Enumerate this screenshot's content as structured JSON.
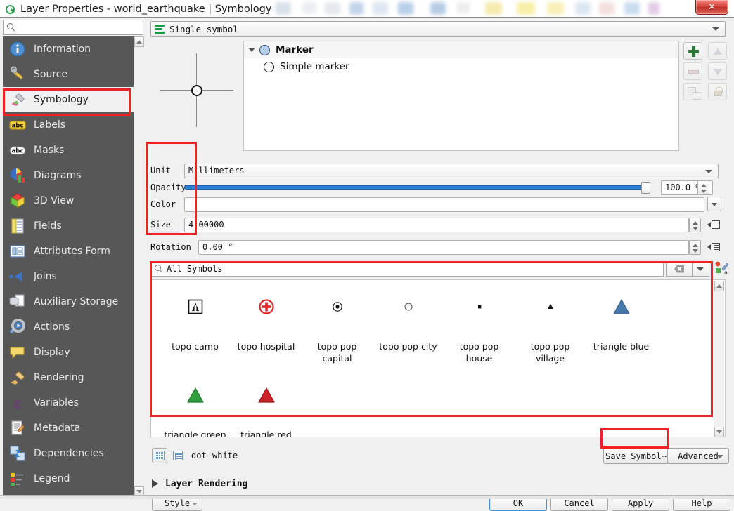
{
  "window": {
    "title": "Layer Properties - world_earthquake | Symbology",
    "app_icon": "qgis-icon",
    "close_label": "✕"
  },
  "left_pane": {
    "search": {
      "value": "",
      "placeholder": ""
    },
    "items": [
      {
        "label": "Information",
        "icon": "info-icon"
      },
      {
        "label": "Source",
        "icon": "source-icon"
      },
      {
        "label": "Symbology",
        "icon": "symbology-brush-icon",
        "selected": true
      },
      {
        "label": "Labels",
        "icon": "labels-abc-icon"
      },
      {
        "label": "Masks",
        "icon": "masks-abc-icon"
      },
      {
        "label": "Diagrams",
        "icon": "diagrams-icon"
      },
      {
        "label": "3D View",
        "icon": "cube-3d-icon"
      },
      {
        "label": "Fields",
        "icon": "fields-icon"
      },
      {
        "label": "Attributes Form",
        "icon": "attributes-form-icon"
      },
      {
        "label": "Joins",
        "icon": "joins-icon"
      },
      {
        "label": "Auxiliary Storage",
        "icon": "auxiliary-storage-icon"
      },
      {
        "label": "Actions",
        "icon": "actions-gear-icon"
      },
      {
        "label": "Display",
        "icon": "display-balloon-icon"
      },
      {
        "label": "Rendering",
        "icon": "rendering-brush-icon"
      },
      {
        "label": "Variables",
        "icon": "variables-epsilon-icon"
      },
      {
        "label": "Metadata",
        "icon": "metadata-icon"
      },
      {
        "label": "Dependencies",
        "icon": "dependencies-icon"
      },
      {
        "label": "Legend",
        "icon": "legend-icon"
      }
    ]
  },
  "renderer": {
    "label": "Single symbol",
    "icon": "single-symbol-icon"
  },
  "symbol_tree": {
    "root": {
      "label": "Marker",
      "icon": "marker-circle-icon"
    },
    "child": {
      "label": "Simple marker",
      "icon": "simple-marker-circle-icon"
    }
  },
  "layer_tools": [
    {
      "name": "add-symbol-layer-button",
      "icon": "plus-icon",
      "enabled": true
    },
    {
      "name": "remove-symbol-layer-button",
      "icon": "minus-icon",
      "enabled": false
    },
    {
      "name": "duplicate-symbol-layer-button",
      "icon": "duplicate-icon",
      "enabled": false
    },
    {
      "name": "move-up-button",
      "icon": "arrow-up-icon",
      "enabled": false
    },
    {
      "name": "move-down-button",
      "icon": "arrow-down-icon",
      "enabled": false
    },
    {
      "name": "lock-layer-button",
      "icon": "lock-icon",
      "enabled": false
    }
  ],
  "properties": {
    "unit": {
      "label": "Unit",
      "value": "Millimeters"
    },
    "opacity": {
      "label": "Opacity",
      "value": "100.0 %",
      "percent": 100
    },
    "color": {
      "label": "Color",
      "value": "",
      "swatch": "#ffffff"
    },
    "size": {
      "label": "Size",
      "value": "4.00000"
    },
    "rotation": {
      "label": "Rotation",
      "value": "0.00 °"
    }
  },
  "symbol_search": {
    "value": "All Symbols",
    "icon": "search-icon",
    "clear_icon": "clear-icon",
    "style_manager_icon": "style-manager-icon"
  },
  "symbols": [
    {
      "name": "topo camp",
      "icon": "topo-camp-icon"
    },
    {
      "name": "topo hospital",
      "icon": "topo-hospital-icon"
    },
    {
      "name": "topo pop capital",
      "icon": "topo-pop-capital-icon"
    },
    {
      "name": "topo pop city",
      "icon": "topo-pop-city-icon"
    },
    {
      "name": "topo pop house",
      "icon": "topo-pop-house-icon"
    },
    {
      "name": "topo pop village",
      "icon": "topo-pop-village-icon"
    },
    {
      "name": "triangle blue",
      "icon": "triangle-blue-icon"
    },
    {
      "name": "triangle green",
      "icon": "triangle-green-icon"
    },
    {
      "name": "triangle red",
      "icon": "triangle-red-icon"
    }
  ],
  "bottom_bar": {
    "view_grid_icon": "grid-view-icon",
    "view_list_icon": "list-view-icon",
    "tag_1": "dot",
    "tag_2": "white",
    "save_symbol": "Save Symbol⋯",
    "advanced": "Advanced"
  },
  "layer_rendering": {
    "label": "Layer Rendering"
  },
  "buttons": {
    "style": "Style",
    "ok": "OK",
    "cancel": "Cancel",
    "apply": "Apply",
    "help": "Help"
  },
  "colors": {
    "accent_blue": "#2f7fd4",
    "nav_background": "#575757",
    "annotation_red": "#ee2222",
    "symbol_blue": "#4a79ae",
    "symbol_green": "#2f9e3f",
    "symbol_red": "#cc2229"
  }
}
